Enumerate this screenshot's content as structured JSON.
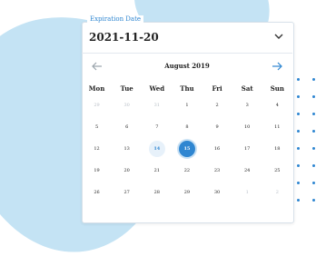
{
  "field": {
    "label": "Expiration Date",
    "value": "2021-11-20"
  },
  "calendar": {
    "month": "August 2019",
    "weekdays": [
      "Mon",
      "Tue",
      "Wed",
      "Thu",
      "Fri",
      "Sat",
      "Sun"
    ],
    "weeks": [
      [
        "29",
        "30",
        "31",
        "1",
        "2",
        "3",
        "4"
      ],
      [
        "5",
        "6",
        "7",
        "8",
        "9",
        "10",
        "11"
      ],
      [
        "12",
        "13",
        "14",
        "15",
        "16",
        "17",
        "18"
      ],
      [
        "19",
        "20",
        "21",
        "22",
        "23",
        "24",
        "25"
      ],
      [
        "26",
        "27",
        "28",
        "29",
        "30",
        "1",
        "2"
      ]
    ]
  },
  "colors": {
    "accent": "#2f86d1",
    "accent_light": "#c4e3f4",
    "muted": "#b7bec6"
  },
  "icons": {
    "prev": "arrow-left-icon",
    "next": "arrow-right-icon",
    "dropdown": "chevron-down-icon"
  }
}
